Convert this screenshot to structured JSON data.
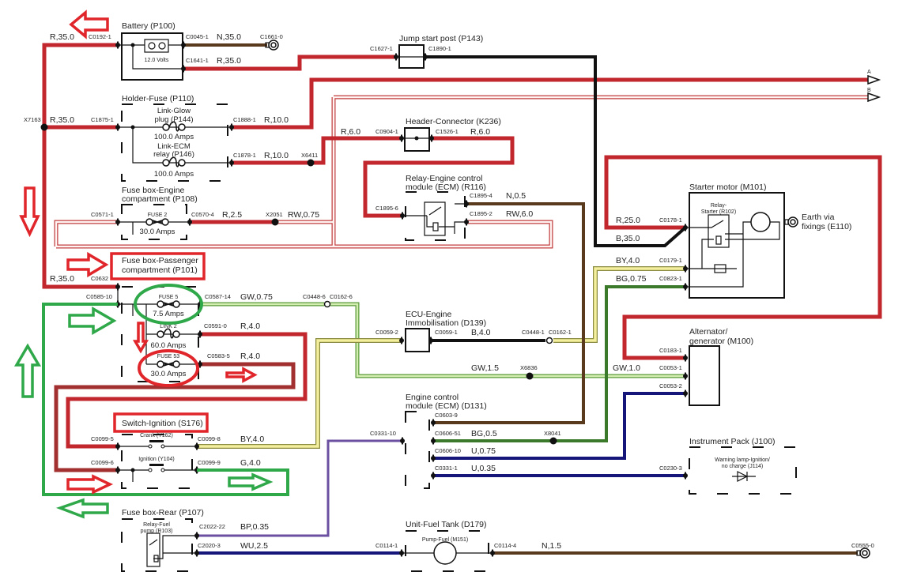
{
  "components": {
    "battery": {
      "title": "Battery (P100)",
      "voltage": "12.0 Volts"
    },
    "jump_start": {
      "title": "Jump start post (P143)"
    },
    "holder_fuse": {
      "title": "Holder-Fuse (P110)",
      "link_glow": [
        "Link-Glow",
        "plug (P144)"
      ],
      "link_glow_rating": "100.0 Amps",
      "link_ecm": [
        "Link-ECM",
        "relay (P146)"
      ],
      "link_ecm_rating": "100.0 Amps"
    },
    "header_connector": {
      "title": "Header-Connector (K236)"
    },
    "relay_ecm": {
      "title": [
        "Relay-Engine control",
        "module (ECM) (R116)"
      ]
    },
    "fuse_engine": {
      "title": [
        "Fuse box-Engine",
        "compartment (P108)"
      ],
      "fuse": "FUSE 2",
      "rating": "30.0 Amps"
    },
    "fuse_passenger": {
      "title": [
        "Fuse box-Passenger",
        "compartment (P101)"
      ],
      "fuse5": "FUSE 5",
      "fuse5_rating": "7.5 Amps",
      "link2": "LINK 2",
      "link2_rating": "60.0 Amps",
      "fuse53": "FUSE 53",
      "fuse53_rating": "30.0 Amps"
    },
    "switch_ignition": {
      "title": "Switch-Ignition (S176)",
      "crank": "Crank (Y162)",
      "ignition": "Ignition (Y104)"
    },
    "fuse_rear": {
      "title": "Fuse box-Rear (P107)",
      "relay": [
        "Relay-Fuel",
        "pump (R103)"
      ]
    },
    "ecu_immob": {
      "title": [
        "ECU-Engine",
        "Immobilisation (D139)"
      ]
    },
    "ecm": {
      "title": [
        "Engine control",
        "module (ECM) (D131)"
      ]
    },
    "starter": {
      "title": "Starter motor (M101)",
      "relay": [
        "Relay-",
        "Starter (R102)"
      ],
      "earth": [
        "Earth via",
        "fixings (E110)"
      ]
    },
    "alternator": {
      "title": [
        "Alternator/",
        "generator (M100)"
      ]
    },
    "instrument": {
      "title": "Instrument Pack (J100)",
      "lamp": [
        "Warning lamp-Ignition/",
        "no charge (J114)"
      ]
    },
    "fuel_tank": {
      "title": "Unit-Fuel Tank (D179)",
      "pump": "Pump-Fuel (M151)"
    }
  },
  "connectors": [
    "C0192-1",
    "C0045-1",
    "C1661-0",
    "C1641-1",
    "C1627-1",
    "C1890-1",
    "C1875-1",
    "C1888-1",
    "C1878-1",
    "C0904-1",
    "C1526-1",
    "C1895-6",
    "C1895-4",
    "C1895-2",
    "C0571-1",
    "C0570-4",
    "C0632",
    "C0178-1",
    "C0179-1",
    "C0823-1",
    "C0585-10",
    "C0587-14",
    "C0448-6",
    "C0162-6",
    "C0591-0",
    "C0583-5",
    "C0059-2",
    "C0059-1",
    "C0448-1",
    "C0162-1",
    "C0183-1",
    "C0053-1",
    "C0053-2",
    "C0603-9",
    "C0606-51",
    "C0606-10",
    "C0331-1",
    "C0331-10",
    "C0230-3",
    "C0099-5",
    "C0099-8",
    "C0099-6",
    "C0099-9",
    "C2022-22",
    "C2020-3",
    "C0114-1",
    "C0114-4",
    "C0555-0"
  ],
  "wire_labels": [
    "R,35.0",
    "N,35.0",
    "R,35.0",
    "R,35.0",
    "R,10.0",
    "R,10.0",
    "R,6.0",
    "R,6.0",
    "N,0.5",
    "RW,6.0",
    "R,2.5",
    "RW,0.75",
    "R,35.0",
    "R,25.0",
    "B,35.0",
    "BY,4.0",
    "BG,0.75",
    "GW,0.75",
    "R,4.0",
    "R,4.0",
    "B,4.0",
    "GW,1.5",
    "GW,1.0",
    "BG,0.5",
    "U,0.75",
    "U,0.35",
    "BY,4.0",
    "G,4.0",
    "BP,0.35",
    "WU,2.5",
    "N,1.5"
  ],
  "splices": [
    "X7163",
    "X6411",
    "X2051",
    "X6836",
    "X8041"
  ],
  "harness_outputs": [
    "A",
    "B"
  ],
  "colors": {
    "wire_red": "#c1272d",
    "wire_red_dark": "#a33030",
    "wire_brown": "#5a3a1c",
    "wire_black": "#111111",
    "wire_green": "#3a7a2a",
    "wire_blue": "#16167a",
    "wire_purple": "#6b4fa0",
    "wire_yellow": "#f3ef9e",
    "wire_light_green": "#d3eeb0",
    "annotation_red": "#e0262b",
    "annotation_green": "#2fa84a"
  }
}
